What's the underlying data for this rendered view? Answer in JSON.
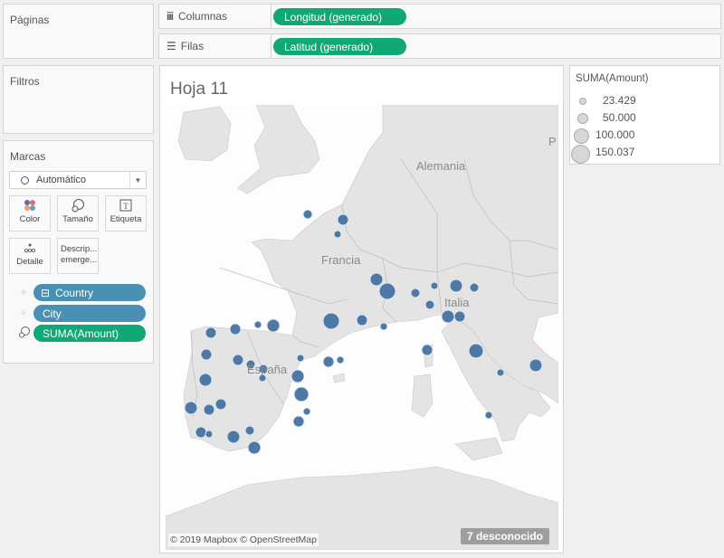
{
  "pages_panel": {
    "title": "Páginas"
  },
  "filters_panel": {
    "title": "Filtros"
  },
  "shelves": {
    "columns": {
      "icon": "columns-icon",
      "label": "Columnas",
      "pill": "Longitud (generado)"
    },
    "rows": {
      "icon": "rows-icon",
      "label": "Filas",
      "pill": "Latitud (generado)"
    }
  },
  "marks": {
    "title": "Marcas",
    "mark_type": "Automático",
    "buttons": [
      {
        "icon": "color-icon",
        "label": "Color"
      },
      {
        "icon": "size-icon",
        "label": "Tamaño"
      },
      {
        "icon": "label-icon",
        "label": "Etiqueta"
      },
      {
        "icon": "detail-icon",
        "label": "Detalle"
      },
      {
        "icon": "tooltip-icon",
        "label": "Descrip... emerge..."
      }
    ],
    "fields": [
      {
        "type": "detail",
        "label": "Country",
        "color": "#4a90b2",
        "expand": "⊟"
      },
      {
        "type": "detail",
        "label": "City",
        "color": "#4a90b2"
      },
      {
        "type": "size",
        "label": "SUMA(Amount)",
        "color": "#0fa876"
      }
    ]
  },
  "sheet": {
    "title": "Hoja 11",
    "map_labels": {
      "germany": "Alemania",
      "france": "Francia",
      "italy": "Italia",
      "spain": "España",
      "poland_partial": "P"
    },
    "attribution": "© 2019 Mapbox © OpenStreetMap",
    "unknown_badge": "7 desconocido",
    "mark_color": "#4e79a7"
  },
  "legend": {
    "title": "SUMA(Amount)",
    "items": [
      "23.429",
      "50.000",
      "100.000",
      "150.037"
    ]
  },
  "colors": {
    "green_pill": "#0fa876",
    "blue_pill": "#4a90b2",
    "mark": "#4e79a7"
  }
}
